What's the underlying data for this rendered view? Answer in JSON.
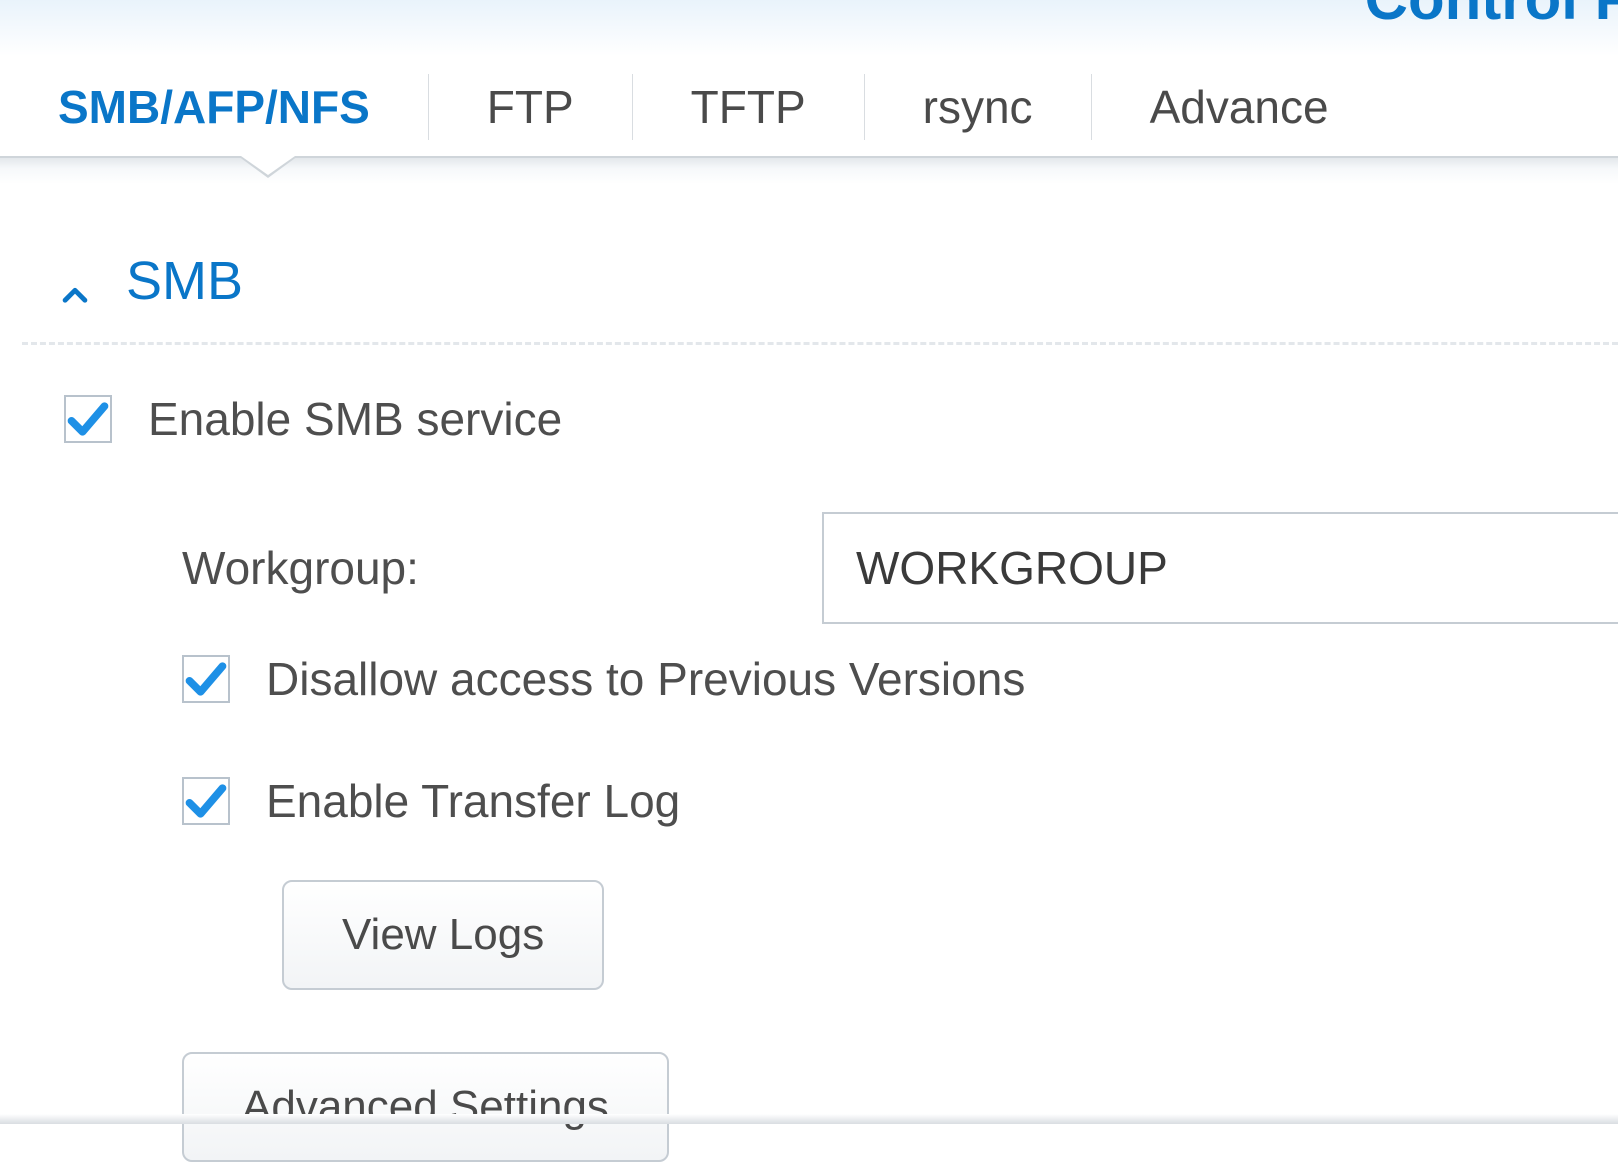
{
  "header": {
    "title_fragment": "Control Pa"
  },
  "tabs": {
    "items": [
      {
        "label": "SMB/AFP/NFS",
        "active": true
      },
      {
        "label": "FTP",
        "active": false
      },
      {
        "label": "TFTP",
        "active": false
      },
      {
        "label": "rsync",
        "active": false
      },
      {
        "label": "Advance",
        "active": false
      }
    ]
  },
  "section": {
    "title": "SMB",
    "expanded": true
  },
  "smb": {
    "enable": {
      "label": "Enable SMB service",
      "checked": true
    },
    "workgroup_label": "Workgroup:",
    "workgroup_value": "WORKGROUP",
    "disallow_previous": {
      "label": "Disallow access to Previous Versions",
      "checked": true
    },
    "transfer_log": {
      "label": "Enable Transfer Log",
      "checked": true
    },
    "view_logs_label": "View Logs",
    "advanced_settings_label": "Advanced Settings"
  },
  "colors": {
    "accent": "#0a76c8"
  }
}
